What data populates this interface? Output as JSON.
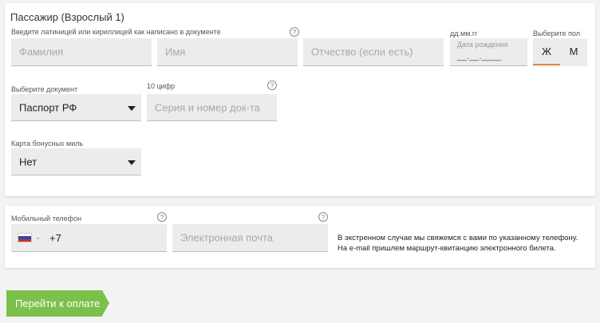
{
  "passenger": {
    "title": "Пассажир (Взрослый 1)",
    "name_hint": "Введите латиницей или кириллицей как написано в документе",
    "help": "?",
    "surname_placeholder": "Фамилия",
    "firstname_placeholder": "Имя",
    "middlename_placeholder": "Отчество (если есть)",
    "dob_label": "дд.мм.гг",
    "dob_placeholder": "Дата рождения",
    "dob_mask": "__.__.____",
    "gender_label": "Выберите пол",
    "gender_female": "Ж",
    "gender_male": "М",
    "doc_label": "Выберите документ",
    "doc_value": "Паспорт РФ",
    "doc_number_label": "10 цифр",
    "doc_number_placeholder": "Серия и номер док-та",
    "miles_label": "Карта бонусных миль",
    "miles_value": "Нет"
  },
  "contacts": {
    "phone_label": "Мобильный телефон",
    "phone_prefix": "+7",
    "email_placeholder": "Электронная почта",
    "note_line1": "В экстренном случае мы свяжемся с вами по указанному телефону.",
    "note_line2": "На e-mail пришлем маршрут-квитанцию электронного билета."
  },
  "actions": {
    "pay_label": "Перейти к оплате"
  },
  "colors": {
    "accent_green": "#7cc04b",
    "accent_orange": "#e08a3c"
  }
}
